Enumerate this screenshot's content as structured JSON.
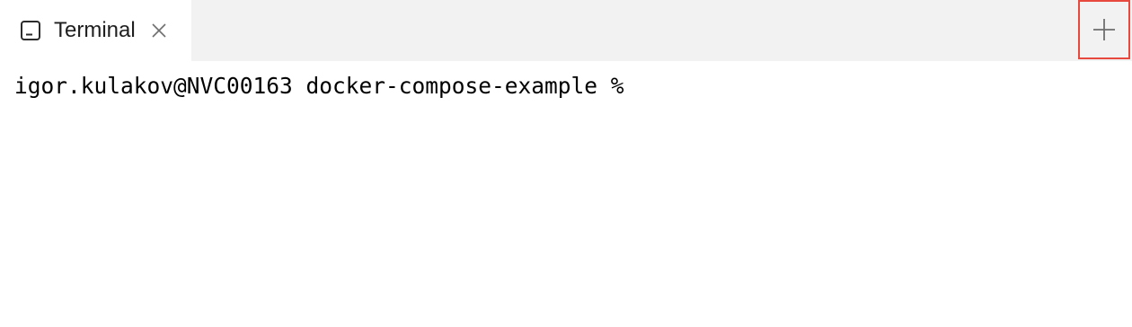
{
  "tabs": [
    {
      "label": "Terminal",
      "icon": "terminal-icon",
      "active": true
    }
  ],
  "new_tab_icon": "plus-icon",
  "terminal": {
    "prompt": "igor.kulakov@NVC00163 docker-compose-example %"
  },
  "colors": {
    "tabbar_bg": "#f2f2f2",
    "active_tab_bg": "#ffffff",
    "highlight_border": "#e8493f"
  }
}
